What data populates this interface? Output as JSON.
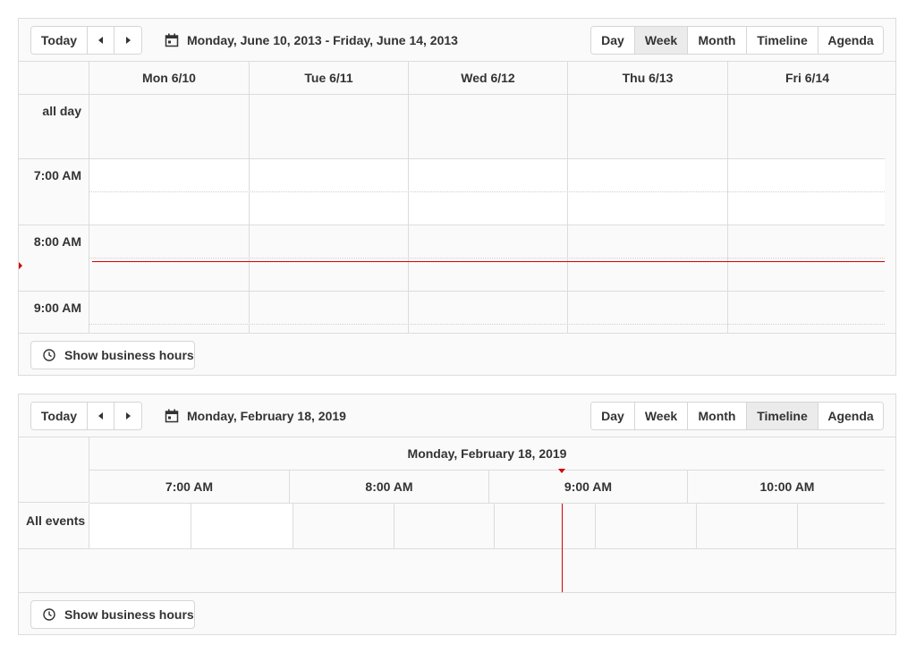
{
  "schedulers": [
    {
      "toolbar": {
        "today": "Today",
        "date_range": "Monday, June 10, 2013 - Friday, June 14, 2013",
        "views": [
          "Day",
          "Week",
          "Month",
          "Timeline",
          "Agenda"
        ],
        "active_view": "Week"
      },
      "days": [
        "Mon 6/10",
        "Tue 6/11",
        "Wed 6/12",
        "Thu 6/13",
        "Fri 6/14"
      ],
      "all_day_label": "all day",
      "times": [
        "7:00 AM",
        "8:00 AM",
        "9:00 AM"
      ],
      "footer": {
        "business_hours": "Show business hours"
      }
    },
    {
      "toolbar": {
        "today": "Today",
        "date_range": "Monday, February 18, 2019",
        "views": [
          "Day",
          "Week",
          "Month",
          "Timeline",
          "Agenda"
        ],
        "active_view": "Timeline"
      },
      "date_header": "Monday, February 18, 2019",
      "hours": [
        "7:00 AM",
        "8:00 AM",
        "9:00 AM",
        "10:00 AM"
      ],
      "row_label": "All events",
      "footer": {
        "business_hours": "Show business hours"
      }
    }
  ],
  "colors": {
    "now_indicator": "#d40000",
    "border": "#dcdcdc",
    "active_view_bg": "#ebebeb"
  },
  "icons": {
    "calendar": "calendar-icon",
    "clock": "clock-icon",
    "prev": "arrow-left-icon",
    "next": "arrow-right-icon"
  }
}
